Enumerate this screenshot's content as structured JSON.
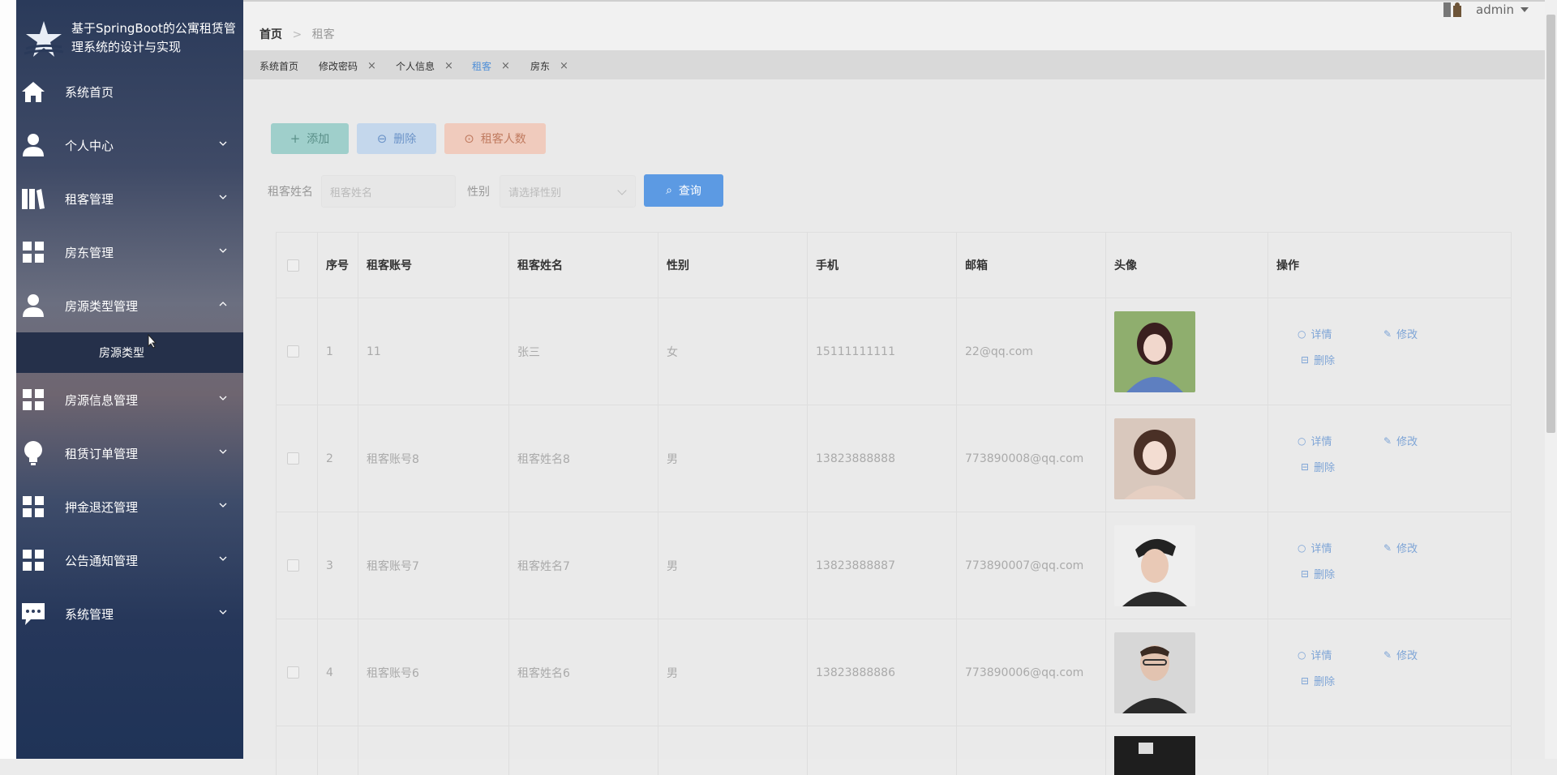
{
  "app": {
    "title": "基于SpringBoot的公寓租赁管理系统的设计与实现"
  },
  "sidebar": {
    "items": [
      {
        "label": "系统首页",
        "icon": "home-icon"
      },
      {
        "label": "个人中心",
        "icon": "user-icon"
      },
      {
        "label": "租客管理",
        "icon": "books-icon"
      },
      {
        "label": "房东管理",
        "icon": "grid-icon"
      },
      {
        "label": "房源类型管理",
        "icon": "user-icon",
        "expanded": true
      },
      {
        "label": "房源信息管理",
        "icon": "grid-icon"
      },
      {
        "label": "租赁订单管理",
        "icon": "bulb-icon"
      },
      {
        "label": "押金退还管理",
        "icon": "grid-icon"
      },
      {
        "label": "公告通知管理",
        "icon": "grid-icon"
      },
      {
        "label": "系统管理",
        "icon": "chat-icon"
      }
    ],
    "submenu": {
      "label": "房源类型"
    }
  },
  "header": {
    "breadcrumb": {
      "home": "首页",
      "separator": ">",
      "current": "租客"
    },
    "user": {
      "name": "admin"
    }
  },
  "tabs": [
    {
      "label": "系统首页"
    },
    {
      "label": "修改密码",
      "close": "×"
    },
    {
      "label": "个人信息",
      "close": "×"
    },
    {
      "label": "租客",
      "close": "×",
      "active": true
    },
    {
      "label": "房东",
      "close": "×"
    }
  ],
  "toolbar": {
    "add_label": "添加",
    "delete_label": "删除",
    "count_label": "租客人数"
  },
  "filters": {
    "name_label": "租客姓名",
    "name_placeholder": "租客姓名",
    "gender_label": "性别",
    "gender_placeholder": "请选择性别",
    "query_label": "查询"
  },
  "table": {
    "columns": [
      "序号",
      "租客账号",
      "租客姓名",
      "性别",
      "手机",
      "邮箱",
      "头像",
      "操作"
    ],
    "rows": [
      {
        "no": "1",
        "account": "11",
        "name": "张三",
        "gender": "女",
        "phone": "15111111111",
        "email": "22@qq.com"
      },
      {
        "no": "2",
        "account": "租客账号8",
        "name": "租客姓名8",
        "gender": "男",
        "phone": "13823888888",
        "email": "773890008@qq.com"
      },
      {
        "no": "3",
        "account": "租客账号7",
        "name": "租客姓名7",
        "gender": "男",
        "phone": "13823888887",
        "email": "773890007@qq.com"
      },
      {
        "no": "4",
        "account": "租客账号6",
        "name": "租客姓名6",
        "gender": "男",
        "phone": "13823888886",
        "email": "773890006@qq.com"
      }
    ],
    "actions": {
      "detail": "详情",
      "edit": "修改",
      "delete": "删除"
    }
  },
  "colors": {
    "accent": "#5c9ae3",
    "sidebar_bg": "#26375a",
    "link": "#7da4d6"
  }
}
